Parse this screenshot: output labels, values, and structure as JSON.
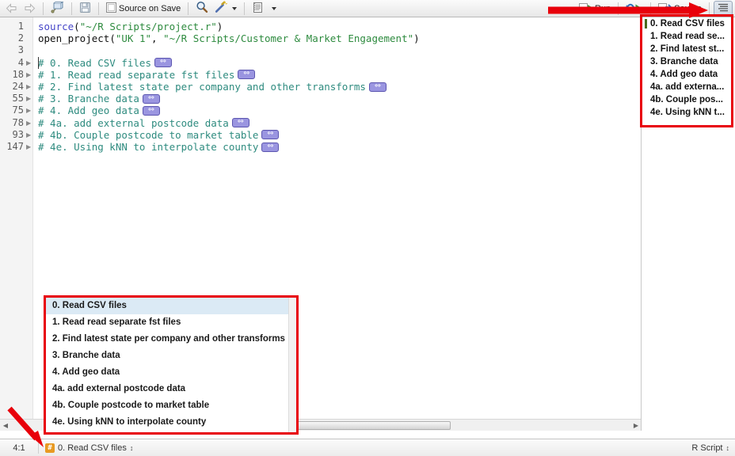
{
  "toolbar": {
    "back_icon": "arrow-left-icon",
    "forward_icon": "arrow-right-icon",
    "popout_icon": "show-in-new-window-icon",
    "save_icon": "save-icon",
    "source_on_save_label": "Source on Save",
    "search_icon": "search-icon",
    "code_tools_icon": "magic-wand-icon",
    "compile_report_icon": "notebook-icon",
    "run_label": "Run",
    "rerun_icon": "rerun-previous-icon",
    "source_label": "Source",
    "outline_icon": "outline-lines-icon"
  },
  "editor": {
    "lines": [
      {
        "num": "1",
        "fold": false,
        "tokens": [
          {
            "t": "source",
            "c": "fn"
          },
          {
            "t": "(",
            "c": "plain"
          },
          {
            "t": "\"~/R Scripts/project.r\"",
            "c": "str"
          },
          {
            "t": ")",
            "c": "plain"
          }
        ]
      },
      {
        "num": "2",
        "fold": false,
        "tokens": [
          {
            "t": "open_project",
            "c": "plain"
          },
          {
            "t": "(",
            "c": "plain"
          },
          {
            "t": "\"UK 1\"",
            "c": "str"
          },
          {
            "t": ", ",
            "c": "plain"
          },
          {
            "t": "\"~/R Scripts/Customer & Market Engagement\"",
            "c": "str"
          },
          {
            "t": ")",
            "c": "plain"
          }
        ]
      },
      {
        "num": "3",
        "fold": false,
        "tokens": []
      },
      {
        "num": "4",
        "fold": true,
        "cursor": true,
        "badge": true,
        "tokens": [
          {
            "t": "# 0. Read CSV files",
            "c": "comment"
          }
        ]
      },
      {
        "num": "18",
        "fold": true,
        "badge": true,
        "tokens": [
          {
            "t": "# 1. Read read separate fst files",
            "c": "comment"
          }
        ]
      },
      {
        "num": "24",
        "fold": true,
        "badge": true,
        "tokens": [
          {
            "t": "# 2. Find latest state per company and other transforms",
            "c": "comment"
          }
        ]
      },
      {
        "num": "55",
        "fold": true,
        "badge": true,
        "tokens": [
          {
            "t": "# 3. Branche data",
            "c": "comment"
          }
        ]
      },
      {
        "num": "75",
        "fold": true,
        "badge": true,
        "tokens": [
          {
            "t": "# 4. Add geo data",
            "c": "comment"
          }
        ]
      },
      {
        "num": "78",
        "fold": true,
        "badge": true,
        "tokens": [
          {
            "t": "# 4a. add external postcode data",
            "c": "comment"
          }
        ]
      },
      {
        "num": "93",
        "fold": true,
        "badge": true,
        "tokens": [
          {
            "t": "# 4b. Couple postcode to market table",
            "c": "comment"
          }
        ]
      },
      {
        "num": "147",
        "fold": true,
        "badge": true,
        "tokens": [
          {
            "t": "# 4e. Using kNN to interpolate county",
            "c": "comment"
          }
        ]
      }
    ]
  },
  "outline": {
    "items": [
      {
        "label": "0. Read CSV files",
        "current": true
      },
      {
        "label": "1. Read read se...",
        "current": false
      },
      {
        "label": "2. Find latest st...",
        "current": false
      },
      {
        "label": "3. Branche data",
        "current": false
      },
      {
        "label": "4. Add geo data",
        "current": false
      },
      {
        "label": "4a. add externa...",
        "current": false
      },
      {
        "label": "4b. Couple pos...",
        "current": false
      },
      {
        "label": "4e. Using kNN t...",
        "current": false
      }
    ]
  },
  "popup": {
    "items": [
      {
        "label": "0. Read CSV files",
        "selected": true
      },
      {
        "label": "1. Read read separate fst files",
        "selected": false
      },
      {
        "label": "2. Find latest state per company and other transforms",
        "selected": false
      },
      {
        "label": "3. Branche data",
        "selected": false
      },
      {
        "label": "4. Add geo data",
        "selected": false
      },
      {
        "label": "4a. add external postcode data",
        "selected": false
      },
      {
        "label": "4b. Couple postcode to market table",
        "selected": false
      },
      {
        "label": "4e. Using kNN to interpolate county",
        "selected": false
      }
    ]
  },
  "statusbar": {
    "cursor_position": "4:1",
    "scope_icon": "hash-section-icon",
    "scope_label": "0. Read CSV files",
    "scope_updown": "↕",
    "file_type": "R Script",
    "file_type_updown": "↕"
  },
  "colors": {
    "annotation_red": "#e8000b",
    "selection_blue": "#dbeaf5",
    "comment_green": "#2e8b7f",
    "string_green": "#2e8b3f",
    "function_blue": "#4646c8",
    "fold_badge_purple": "#9a95e0",
    "current_marker_green": "#4a6b1e",
    "section_icon_orange": "#e89a23"
  }
}
